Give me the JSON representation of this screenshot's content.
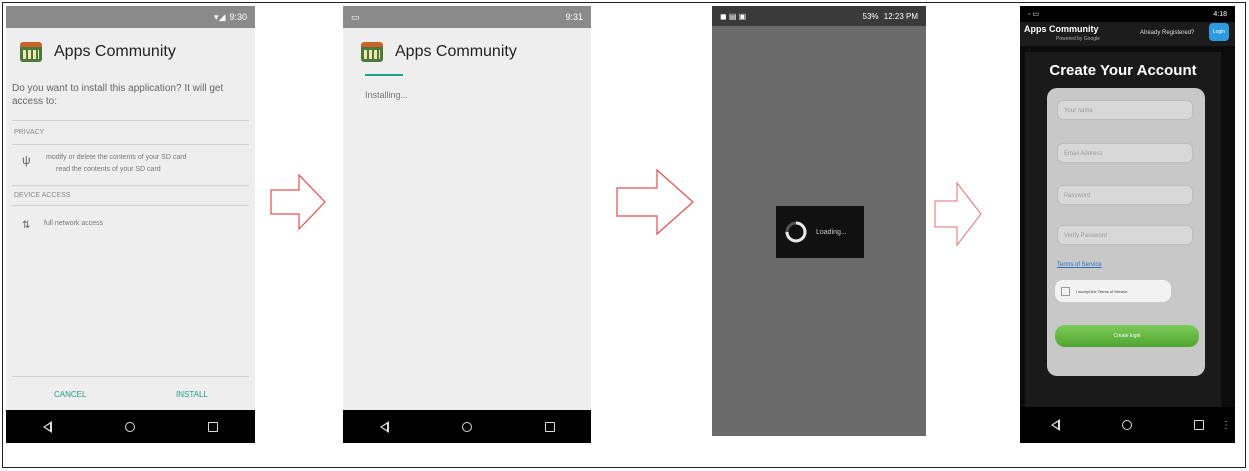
{
  "colors": {
    "teal": "#1e9d8b",
    "green": "#5cb53a",
    "arrow_outline": "#e05050"
  },
  "screen1": {
    "status_time": "9:30",
    "app_title": "Apps Community",
    "prompt": "Do you want to install this application? It will get access to:",
    "privacy_header": "PRIVACY",
    "privacy_item_1": "modify or delete the contents of your SD card",
    "privacy_item_2": "read the contents of your SD card",
    "device_header": "DEVICE ACCESS",
    "device_item": "full network access",
    "cancel_label": "CANCEL",
    "install_label": "INSTALL",
    "privacy_icon": "usb-icon",
    "device_icon": "network-arrows-icon"
  },
  "screen2": {
    "status_time": "9:31",
    "app_title": "Apps Community",
    "installing_text": "Installing..."
  },
  "screen3": {
    "status_time": "12:23 PM",
    "status_battery": "53%",
    "loading_text": "Loading..."
  },
  "screen4": {
    "status_time": "4:18",
    "app_name": "Apps Community",
    "powered_by": "Powered by Google",
    "already_registered": "Already Registered?",
    "login_label": "Login",
    "form_title": "Create Your Account",
    "fields": [
      "Your name",
      "Email Address",
      "Password",
      "Verify Password"
    ],
    "terms_link": "Terms of Service",
    "accept_label": "I accept the Terms of Service",
    "signup_label": "Create login"
  }
}
